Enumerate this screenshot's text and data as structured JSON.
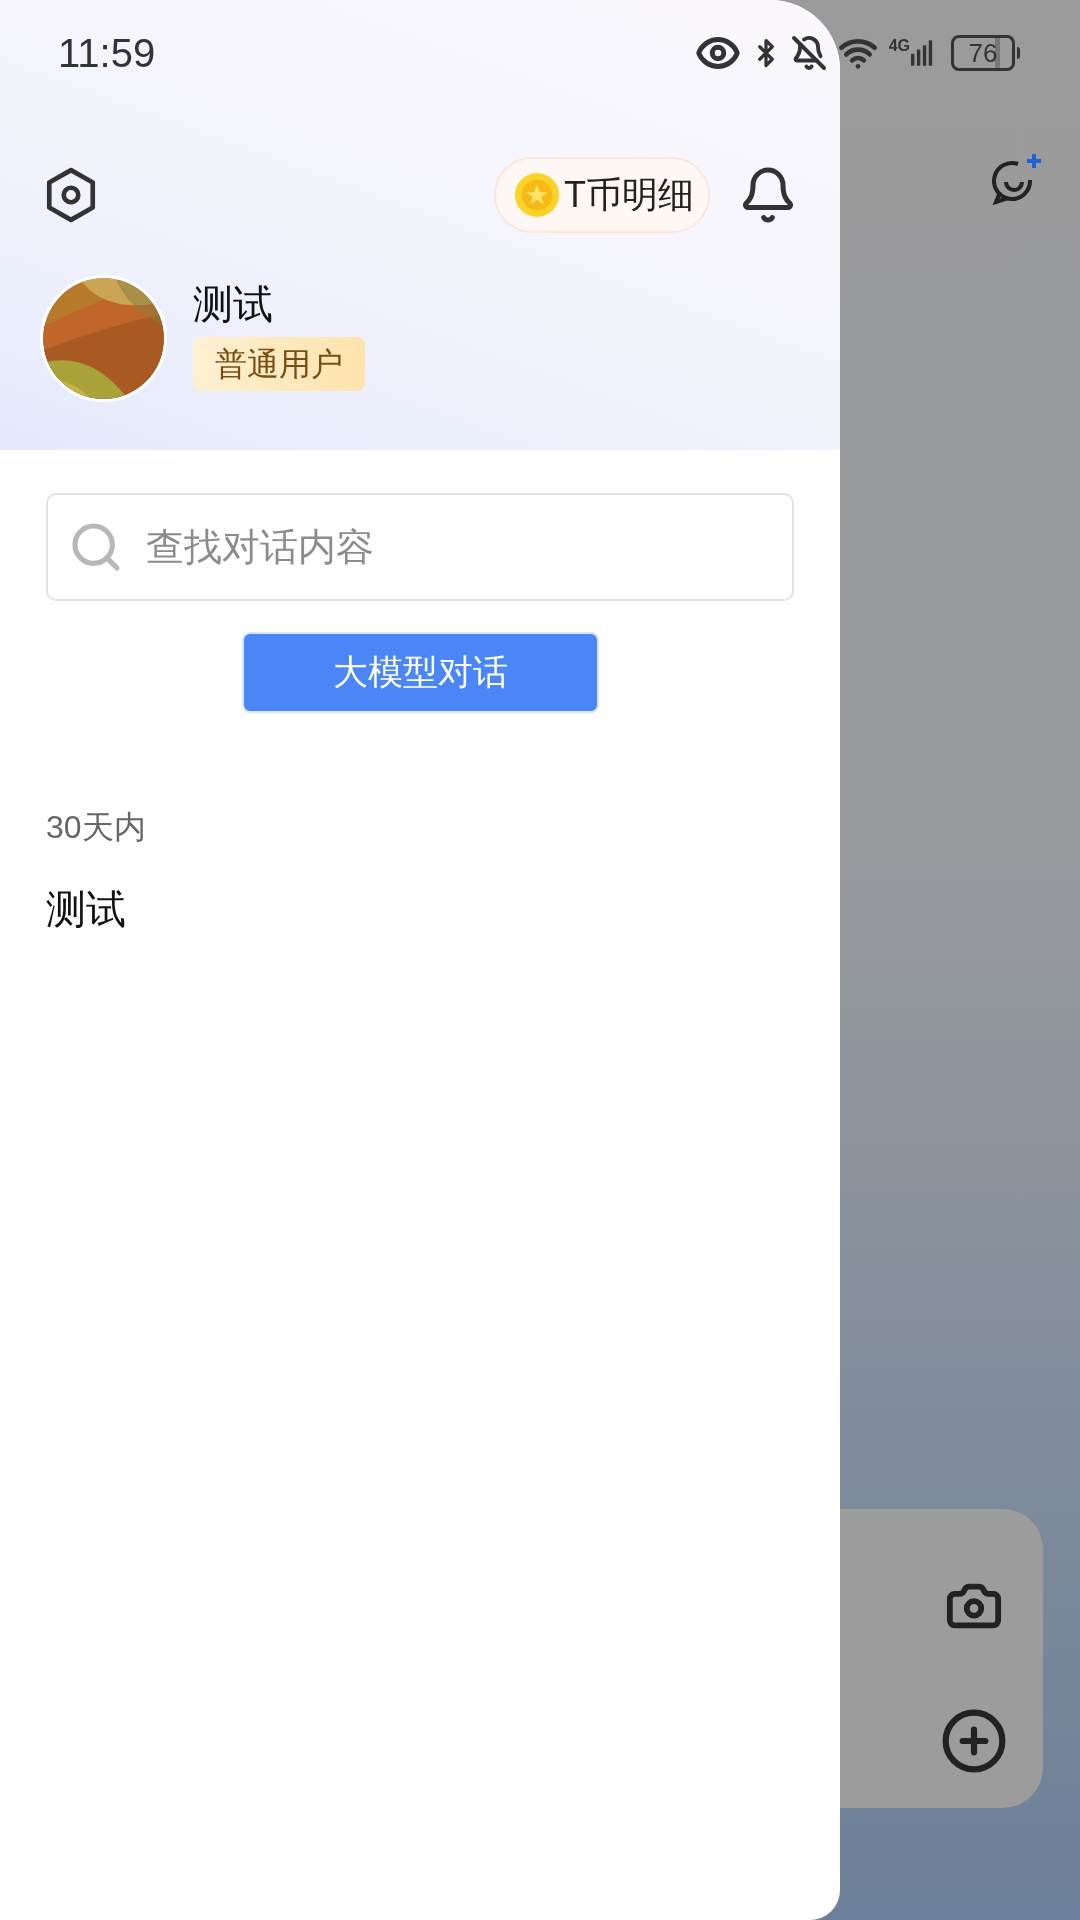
{
  "status_bar": {
    "time": "11:59",
    "network": "4G",
    "battery": "76"
  },
  "header": {
    "coin_button": "T币明细",
    "user": {
      "name": "测试",
      "badge": "普通用户"
    }
  },
  "search": {
    "placeholder": "查找对话内容"
  },
  "new_chat_button": "大模型对话",
  "history": [
    {
      "group": "30天内",
      "items": [
        {
          "title": "测试"
        }
      ]
    }
  ]
}
